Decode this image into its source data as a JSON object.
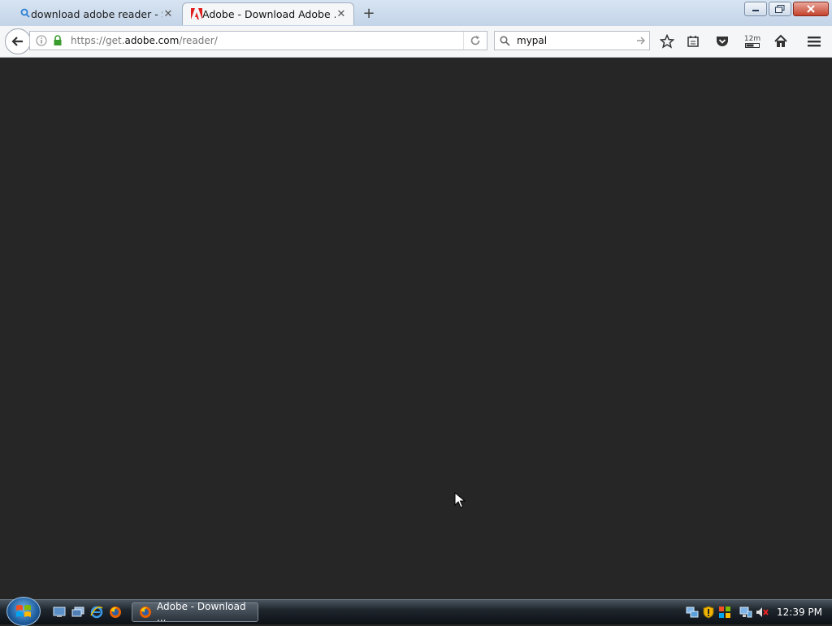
{
  "tabs": [
    {
      "label": "download adobe reader - S...",
      "icon": "search-icon"
    },
    {
      "label": "Adobe - Download Adobe ...",
      "icon": "adobe-icon"
    }
  ],
  "address_bar": {
    "url_prefix": "https://get.",
    "url_domain": "adobe.com",
    "url_path": "/reader/"
  },
  "search_bar": {
    "value": "mypal"
  },
  "toolbar": {
    "badge": "12m"
  },
  "taskbar": {
    "task_label": "Adobe - Download ...",
    "clock": "12:39 PM"
  },
  "colors": {
    "content_bg": "#262626",
    "adobe_red": "#e01e1e",
    "accent_blue": "#2a7fd4"
  }
}
